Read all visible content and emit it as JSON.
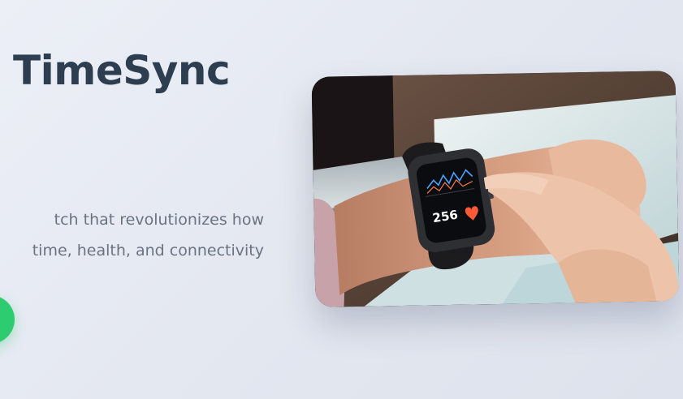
{
  "hero": {
    "title": "TimeSync",
    "tagline_line1": "tch that revolutionizes how",
    "tagline_line2": "time, health, and connectivity",
    "cta_label": "",
    "image_description": "smartwatch-on-wrist-photo"
  },
  "watch_screen": {
    "reading": "256"
  },
  "colors": {
    "title": "#2c3e50",
    "tagline": "#6b7280",
    "cta": "#2ecc71",
    "background": "#e6e9f1"
  }
}
